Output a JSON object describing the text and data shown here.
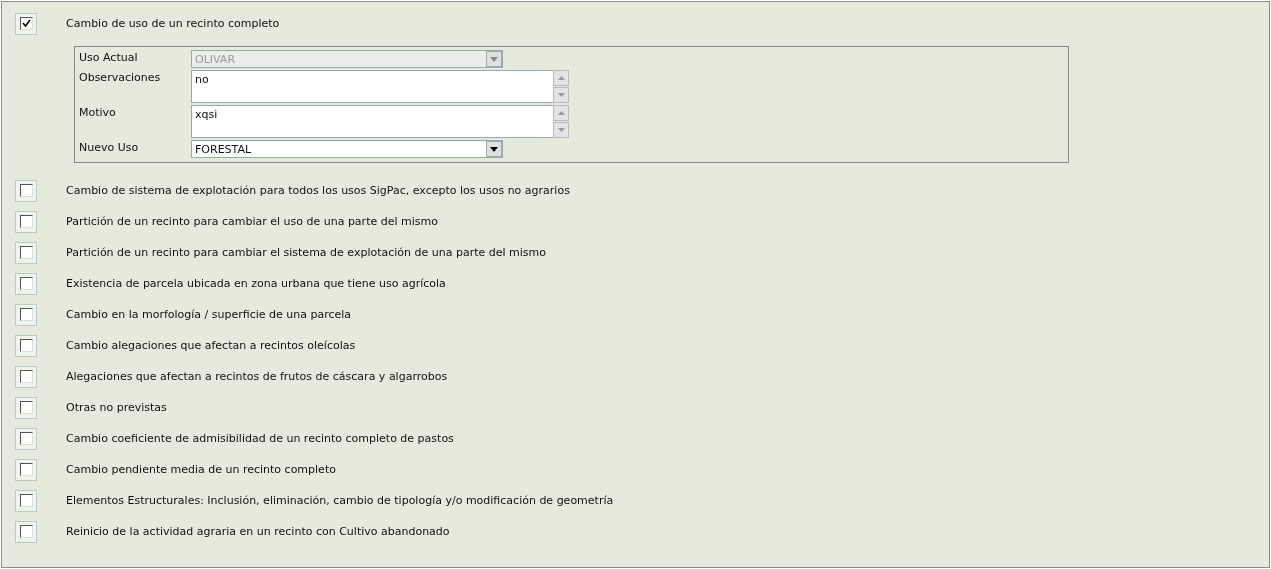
{
  "options": [
    {
      "label": "Cambio de uso de un recinto completo",
      "checked": true,
      "form": {
        "fields": [
          {
            "label": "Uso Actual",
            "kind": "combo",
            "value": "OLIVAR",
            "disabled": true
          },
          {
            "label": "Observaciones",
            "kind": "textarea",
            "value": "no",
            "disabled": false
          },
          {
            "label": "Motivo",
            "kind": "textarea",
            "value": "xqsi",
            "disabled": false
          },
          {
            "label": "Nuevo Uso",
            "kind": "combo",
            "value": "FORESTAL",
            "disabled": false
          }
        ]
      }
    },
    {
      "label": "Cambio de sistema de explotación para todos los usos SigPac, excepto los usos no agrarios",
      "checked": false
    },
    {
      "label": "Partición de un recinto para cambiar el uso de una parte del mismo",
      "checked": false
    },
    {
      "label": "Partición de un recinto para cambiar el sistema de explotación de una parte del mismo",
      "checked": false
    },
    {
      "label": "Existencia de parcela ubicada en zona urbana que tiene uso agrícola",
      "checked": false
    },
    {
      "label": "Cambio en la morfología / superficie de una parcela",
      "checked": false
    },
    {
      "label": "Cambio alegaciones que afectan a recintos oleícolas",
      "checked": false
    },
    {
      "label": "Alegaciones que afectan a recintos de frutos de cáscara y algarrobos",
      "checked": false
    },
    {
      "label": "Otras no previstas",
      "checked": false
    },
    {
      "label": "Cambio coeficiente de admisibilidad de un recinto completo de pastos",
      "checked": false
    },
    {
      "label": "Cambio pendiente media de un recinto completo",
      "checked": false
    },
    {
      "label": "Elementos Estructurales: Inclusión, eliminación, cambio de tipología y/o modificación de geometría",
      "checked": false
    },
    {
      "label": "Reinicio de la actividad agraria en un recinto con Cultivo abandonado",
      "checked": false
    }
  ]
}
